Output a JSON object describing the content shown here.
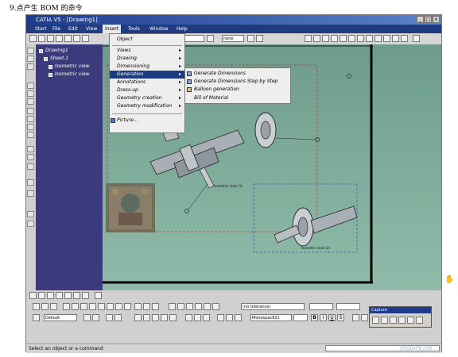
{
  "page_heading": "9.点产生 BOM 的命令",
  "window": {
    "title": "CATIA V5 - [Drawing1]",
    "buttons": [
      "_",
      "□",
      "x"
    ]
  },
  "menubar": {
    "items": [
      "Start",
      "File",
      "Edit",
      "View",
      "Insert",
      "Tools",
      "Window",
      "Help"
    ]
  },
  "toolbar": {
    "field1": "",
    "field2": "none"
  },
  "tree": {
    "root": "Drawing1",
    "sheet": "Sheet.1",
    "views": [
      "Isometric view",
      "Isometric view"
    ]
  },
  "insert_menu": {
    "items": [
      {
        "label": "Object",
        "arrow": false
      },
      {
        "label": "Views",
        "arrow": true
      },
      {
        "label": "Drawing",
        "arrow": true
      },
      {
        "label": "Dimensioning",
        "arrow": true
      },
      {
        "label": "Generation",
        "arrow": true,
        "highlighted": true
      },
      {
        "label": "Annotations",
        "arrow": true
      },
      {
        "label": "Dress-up",
        "arrow": true
      },
      {
        "label": "Geometry creation",
        "arrow": true
      },
      {
        "label": "Geometry modification",
        "arrow": true
      },
      {
        "label": "Picture...",
        "arrow": false
      }
    ]
  },
  "generation_submenu": {
    "items": [
      "Generate Dimensions",
      "Generate Dimensions Step by Step",
      "Balloon generation",
      "Bill of Material"
    ]
  },
  "drawing": {
    "view_labels": [
      "Isometric view (1)",
      "Isometric view (2)"
    ]
  },
  "bottom_toolbar": {
    "tolerance": "(no tolerance)",
    "style": "Default",
    "font": "Monospac821",
    "format_buttons": [
      "B",
      "I",
      "U",
      "S"
    ]
  },
  "capture_panel": {
    "title": "Capture"
  },
  "statusbar": {
    "message": "Select an object or a command"
  },
  "watermark": "inspire.cn"
}
